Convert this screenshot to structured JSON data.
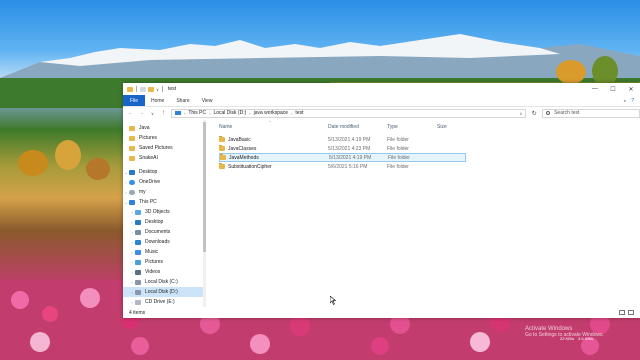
{
  "window": {
    "title": "test",
    "title_dropdown": "∨",
    "controls": {
      "minimize": "—",
      "maximize": "☐",
      "close": "✕"
    }
  },
  "ribbon": {
    "file": "File",
    "tabs": [
      "Home",
      "Share",
      "View"
    ],
    "expand": "∨",
    "help": "?"
  },
  "nav_buttons": {
    "back": "←",
    "forward": "→",
    "recent": "∨",
    "up": "↑"
  },
  "address": {
    "crumbs": [
      "This PC",
      "Local Disk (D:)",
      "java workspace",
      "test"
    ],
    "dropdown": "∨",
    "refresh": "↻"
  },
  "search": {
    "placeholder": "Search test"
  },
  "sidebar": {
    "items": [
      {
        "label": "Java",
        "icon": "folder-icon"
      },
      {
        "label": "Pictures",
        "icon": "folder-icon"
      },
      {
        "label": "Saved Pictures",
        "icon": "folder-icon"
      },
      {
        "label": "SnakeAI",
        "icon": "folder-icon"
      },
      {
        "label": "Desktop",
        "icon": "desktop-icon"
      },
      {
        "label": "OneDrive",
        "icon": "onedrive-icon"
      },
      {
        "label": "my",
        "icon": "user-icon"
      },
      {
        "label": "This PC",
        "icon": "pc-icon"
      },
      {
        "label": "3D Objects",
        "icon": "3d-objects-icon"
      },
      {
        "label": "Desktop",
        "icon": "desktop-icon"
      },
      {
        "label": "Documents",
        "icon": "documents-icon"
      },
      {
        "label": "Downloads",
        "icon": "downloads-icon"
      },
      {
        "label": "Music",
        "icon": "music-icon"
      },
      {
        "label": "Pictures",
        "icon": "pictures-icon"
      },
      {
        "label": "Videos",
        "icon": "videos-icon"
      },
      {
        "label": "Local Disk (C:)",
        "icon": "drive-icon"
      },
      {
        "label": "Local Disk (D:)",
        "icon": "drive-icon"
      },
      {
        "label": "CD Drive (E:)",
        "icon": "cd-drive-icon"
      }
    ]
  },
  "columns": {
    "name": "Name",
    "date": "Date modified",
    "type": "Type",
    "size": "Size"
  },
  "files": [
    {
      "name": "JavaBasic",
      "date": "5/13/2021 4:19 PM",
      "type": "File folder"
    },
    {
      "name": "JavaClasses",
      "date": "5/13/2021 4:23 PM",
      "type": "File folder"
    },
    {
      "name": "JavaMethods",
      "date": "5/13/2021 4:19 PM",
      "type": "File folder"
    },
    {
      "name": "SubstituationCipher",
      "date": "5/6/2021 5:16 PM",
      "type": "File folder"
    }
  ],
  "status": {
    "count": "4 items"
  },
  "overlay": {
    "line1": "Activate Windows",
    "line2": "Go to Settings to activate Windows.",
    "net_up": "22 KB/s",
    "net_down": "3.6 KB/s"
  },
  "colors": {
    "accent": "#1a64c8",
    "folder": "#e8b84a",
    "selection": "#cce4f7"
  }
}
